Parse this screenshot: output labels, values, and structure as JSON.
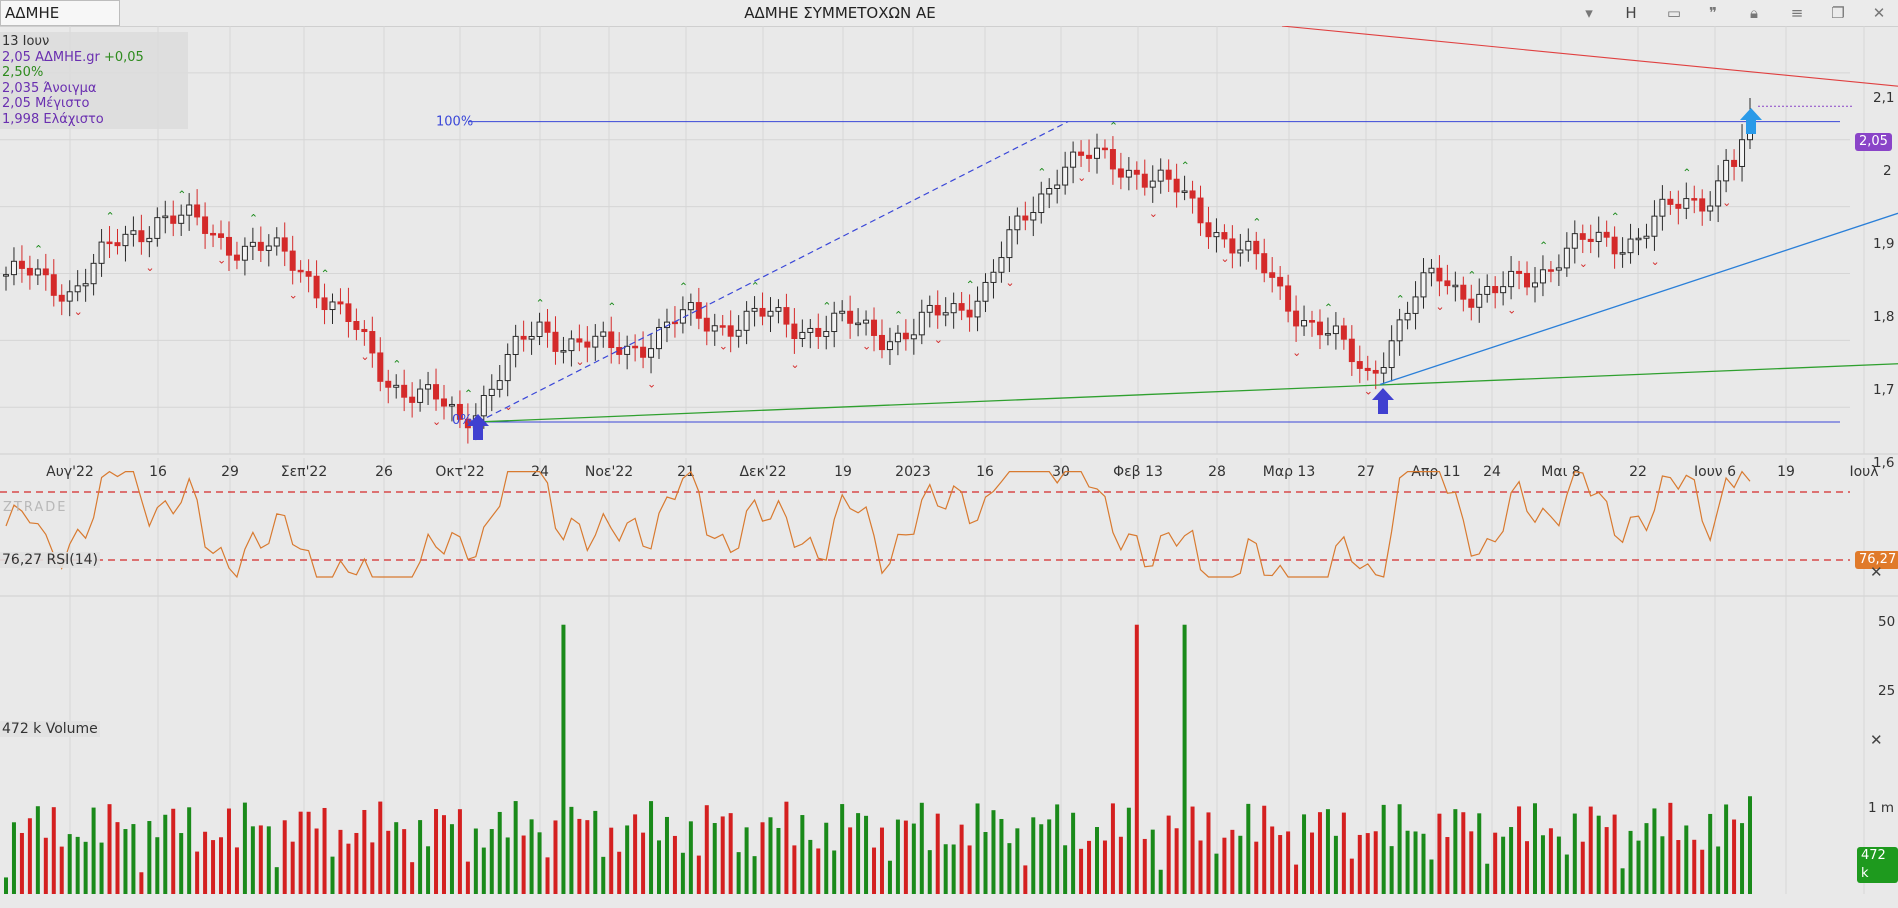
{
  "header": {
    "symbol": "ΑΔΜΗΕ",
    "title": "ΑΔΜΗΕ ΣΥΜΜΕΤΟΧΩΝ ΑΕ",
    "icons": [
      "chevron-down-icon",
      "h-icon",
      "window-icon",
      "quote-icon",
      "lock-icon",
      "menu-icon",
      "restore-icon",
      "close-icon"
    ],
    "h_label": "H"
  },
  "info": {
    "date": "13 Ιουν",
    "last": "2,05 ΑΔΜΗΕ.gr",
    "change": "+0,05 2,50%",
    "open": "2,035 Άνοιγμα",
    "high": "2,05 Μέγιστο",
    "low": "1,998 Ελάχιστο"
  },
  "price_axis": {
    "ticks": [
      "2,1",
      "2",
      "1,9",
      "1,8",
      "1,7",
      "1,6"
    ],
    "last_tag": "2,05",
    "tag_color": "#8a44c8"
  },
  "time_axis": [
    "Αυγ'22",
    "16",
    "29",
    "Σεπ'22",
    "26",
    "Οκτ'22",
    "24",
    "Νοε'22",
    "21",
    "Δεκ'22",
    "19",
    "2023",
    "16",
    "30",
    "Φεβ 13",
    "28",
    "Μαρ 13",
    "27",
    "Απρ 11",
    "24",
    "Μαι 8",
    "22",
    "Ιουν 6",
    "19",
    "Ιουλ"
  ],
  "fib_labels": {
    "top": "100%",
    "bottom": "0%"
  },
  "rsi": {
    "label": "76,27 RSI(14)",
    "tag": "76,27",
    "ticks": [
      "50",
      "25"
    ],
    "tag_color": "#e07a2a"
  },
  "volume": {
    "label": "472 k Volume",
    "tag": "472 k",
    "ticks": [
      "1 m"
    ],
    "tag_color": "#1e9a1e"
  },
  "watermark": "ZTRADE",
  "colors": {
    "up": "#2a2a2a",
    "down": "#d42a2a",
    "rsi_line": "#d87a30",
    "fib": "#3a47d8",
    "support": "#2fa02f",
    "trend": "#2a7fd8",
    "resistance": "#e04040",
    "vol_up": "#1a8a1a",
    "vol_down": "#d42020"
  },
  "chart_data": {
    "type": "candlestick",
    "title": "ΑΔΜΗΕ ΣΥΜΜΕΤΟΧΩΝ ΑΕ",
    "price_range": [
      1.56,
      2.17
    ],
    "rsi_range": [
      10,
      90
    ],
    "rsi_levels": [
      70,
      30
    ],
    "volume_max": 1400000,
    "anchors": [
      {
        "date": "Αυγ'22",
        "price": 1.78
      },
      {
        "date": "16",
        "price": 1.89
      },
      {
        "date": "29",
        "price": 1.85
      },
      {
        "date": "Σεπ'22",
        "price": 1.81
      },
      {
        "date": "26",
        "price": 1.65
      },
      {
        "date": "Οκτ'22",
        "price": 1.58
      },
      {
        "date": "24",
        "price": 1.72
      },
      {
        "date": "Νοε'22",
        "price": 1.68
      },
      {
        "date": "21",
        "price": 1.73
      },
      {
        "date": "Δεκ'22",
        "price": 1.73
      },
      {
        "date": "19",
        "price": 1.72
      },
      {
        "date": "2023",
        "price": 1.71
      },
      {
        "date": "16",
        "price": 1.78
      },
      {
        "date": "30",
        "price": 1.97
      },
      {
        "date": "Φεβ 13",
        "price": 1.96
      },
      {
        "date": "28",
        "price": 1.87
      },
      {
        "date": "Μαρ 13",
        "price": 1.76
      },
      {
        "date": "27",
        "price": 1.65
      },
      {
        "date": "Απρ 11",
        "price": 1.8
      },
      {
        "date": "24",
        "price": 1.76
      },
      {
        "date": "Μαι 8",
        "price": 1.83
      },
      {
        "date": "22",
        "price": 1.86
      },
      {
        "date": "Ιουν 6",
        "price": 1.93
      },
      {
        "date": "Ιουν 13",
        "price": 2.05
      }
    ],
    "fib_levels": {
      "100": 2.027,
      "0": 1.578
    },
    "support_line": [
      {
        "x": "Οκτ'22",
        "price": 1.578
      },
      {
        "x": "Ιουλ",
        "price": 1.665
      }
    ],
    "trend_line": [
      {
        "x": "27",
        "price": 1.634
      },
      {
        "x": "Ιουλ",
        "price": 1.89
      }
    ],
    "resistance_line": [
      {
        "x": "30",
        "price": 2.19
      },
      {
        "x": "Ιουλ",
        "price": 2.08
      }
    ],
    "volume_spikes": [
      {
        "date": "Δεκ'22",
        "value": 1300000
      },
      {
        "date": "30",
        "value": 1300000
      }
    ]
  }
}
